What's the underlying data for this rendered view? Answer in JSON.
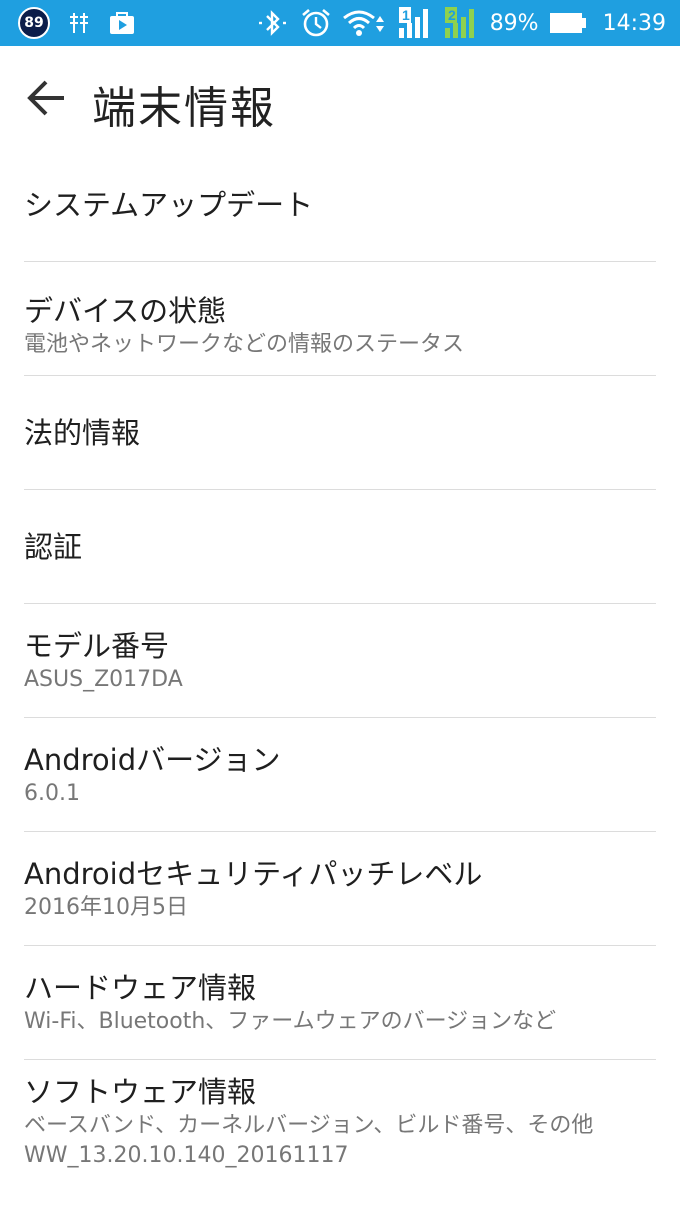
{
  "status_bar": {
    "badge": "89",
    "battery_percent": "89%",
    "time": "14:39",
    "sim1_label": "1",
    "sim2_label": "2",
    "colors": {
      "background": "#1f9fe0",
      "sim2": "#8fd14f"
    },
    "icons": [
      "number-badge-icon",
      "usb-debug-icon",
      "play-store-icon",
      "bluetooth-icon",
      "alarm-icon",
      "wifi-icon",
      "signal-sim1-icon",
      "signal-sim2-icon",
      "battery-icon"
    ]
  },
  "header": {
    "back_icon": "arrow-back-icon",
    "title": "端末情報"
  },
  "items": [
    {
      "title": "システムアップデート",
      "summary": ""
    },
    {
      "title": "デバイスの状態",
      "summary": "電池やネットワークなどの情報のステータス"
    },
    {
      "title": "法的情報",
      "summary": ""
    },
    {
      "title": "認証",
      "summary": ""
    },
    {
      "title": "モデル番号",
      "summary": "ASUS_Z017DA"
    },
    {
      "title": "Androidバージョン",
      "summary": "6.0.1"
    },
    {
      "title": "Androidセキュリティパッチレベル",
      "summary": "2016年10月5日"
    },
    {
      "title": "ハードウェア情報",
      "summary": "Wi-Fi、Bluetooth、ファームウェアのバージョンなど"
    },
    {
      "title": "ソフトウェア情報",
      "summary": "ベースバンド、カーネルバージョン、ビルド番号、その他",
      "summary2": "WW_13.20.10.140_20161117"
    }
  ]
}
